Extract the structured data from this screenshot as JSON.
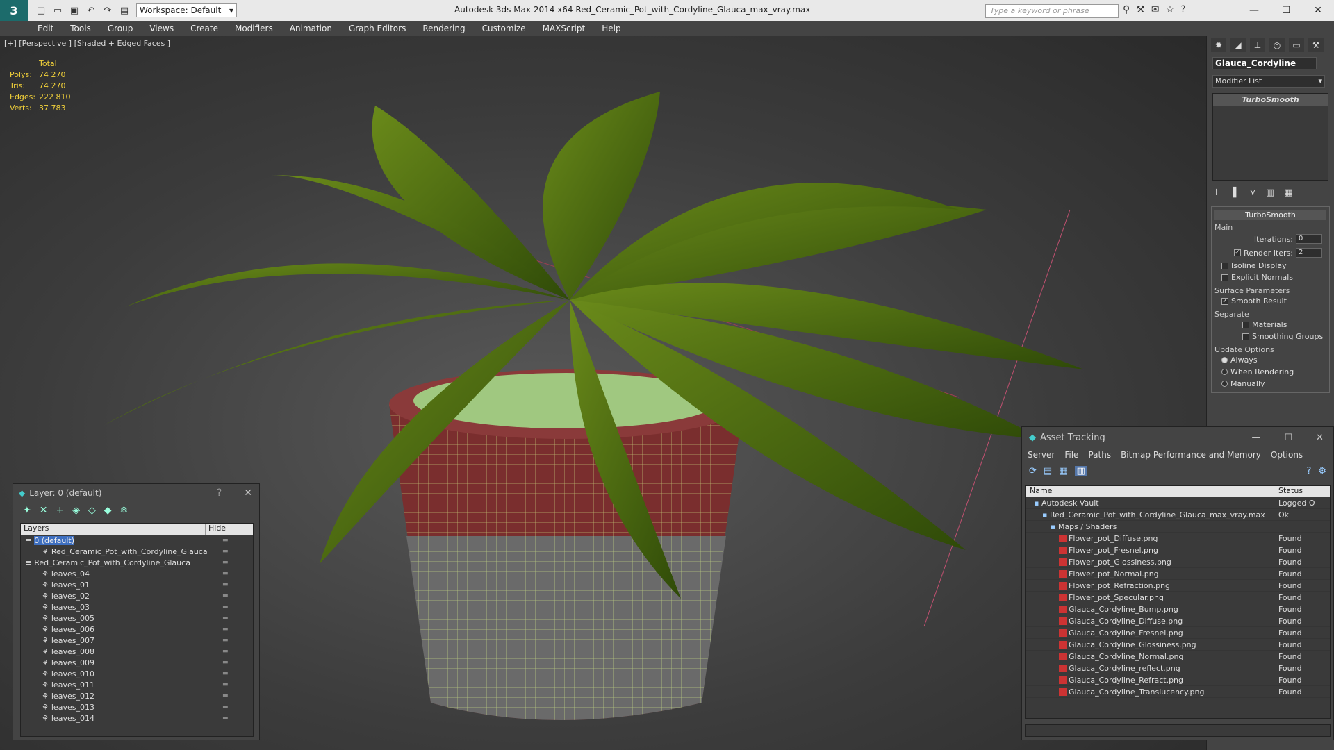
{
  "titlebar": {
    "workspace": "Workspace: Default",
    "title": "Autodesk 3ds Max  2014 x64      Red_Ceramic_Pot_with_Cordyline_Glauca_max_vray.max",
    "search_placeholder": "Type a keyword or phrase"
  },
  "menu": [
    "Edit",
    "Tools",
    "Group",
    "Views",
    "Create",
    "Modifiers",
    "Animation",
    "Graph Editors",
    "Rendering",
    "Customize",
    "MAXScript",
    "Help"
  ],
  "viewport": {
    "label": "[+] [Perspective ] [Shaded + Edged Faces ]",
    "stats_header": "Total",
    "stats": [
      {
        "k": "Polys:",
        "v": "74 270"
      },
      {
        "k": "Tris:",
        "v": "74 270"
      },
      {
        "k": "Edges:",
        "v": "222 810"
      },
      {
        "k": "Verts:",
        "v": "37 783"
      }
    ]
  },
  "command_panel": {
    "object_name": "Glauca_Cordyline",
    "modifier_list": "Modifier List",
    "stack_item": "TurboSmooth",
    "rollout_title": "TurboSmooth",
    "main_label": "Main",
    "iterations_label": "Iterations:",
    "iterations_value": "0",
    "render_iters_label": "Render Iters:",
    "render_iters_value": "2",
    "isoline": "Isoline Display",
    "explicit": "Explicit Normals",
    "surface_label": "Surface Parameters",
    "smooth_result": "Smooth Result",
    "separate": "Separate",
    "materials": "Materials",
    "smoothing_groups": "Smoothing Groups",
    "update_label": "Update Options",
    "always": "Always",
    "when_rendering": "When Rendering",
    "manually": "Manually"
  },
  "layer_window": {
    "title": "Layer: 0 (default)",
    "col_layers": "Layers",
    "col_hide": "Hide",
    "rows": [
      {
        "name": "0 (default)",
        "indent": 0,
        "selected": true
      },
      {
        "name": "Red_Ceramic_Pot_with_Cordyline_Glauca",
        "indent": 2,
        "selected": false
      },
      {
        "name": "Red_Ceramic_Pot_with_Cordyline_Glauca",
        "indent": 0,
        "selected": false
      },
      {
        "name": "leaves_04",
        "indent": 2,
        "selected": false
      },
      {
        "name": "leaves_01",
        "indent": 2,
        "selected": false
      },
      {
        "name": "leaves_02",
        "indent": 2,
        "selected": false
      },
      {
        "name": "leaves_03",
        "indent": 2,
        "selected": false
      },
      {
        "name": "leaves_005",
        "indent": 2,
        "selected": false
      },
      {
        "name": "leaves_006",
        "indent": 2,
        "selected": false
      },
      {
        "name": "leaves_007",
        "indent": 2,
        "selected": false
      },
      {
        "name": "leaves_008",
        "indent": 2,
        "selected": false
      },
      {
        "name": "leaves_009",
        "indent": 2,
        "selected": false
      },
      {
        "name": "leaves_010",
        "indent": 2,
        "selected": false
      },
      {
        "name": "leaves_011",
        "indent": 2,
        "selected": false
      },
      {
        "name": "leaves_012",
        "indent": 2,
        "selected": false
      },
      {
        "name": "leaves_013",
        "indent": 2,
        "selected": false
      },
      {
        "name": "leaves_014",
        "indent": 2,
        "selected": false
      }
    ]
  },
  "asset_window": {
    "title": "Asset Tracking",
    "menu": [
      "Server",
      "File",
      "Paths",
      "Bitmap Performance and Memory",
      "Options"
    ],
    "col_name": "Name",
    "col_status": "Status",
    "rows": [
      {
        "name": "Autodesk Vault",
        "status": "Logged O",
        "indent": 1,
        "png": false
      },
      {
        "name": "Red_Ceramic_Pot_with_Cordyline_Glauca_max_vray.max",
        "status": "Ok",
        "indent": 2,
        "png": false
      },
      {
        "name": "Maps / Shaders",
        "status": "",
        "indent": 3,
        "png": false
      },
      {
        "name": "Flower_pot_Diffuse.png",
        "status": "Found",
        "indent": 4,
        "png": true
      },
      {
        "name": "Flower_pot_Fresnel.png",
        "status": "Found",
        "indent": 4,
        "png": true
      },
      {
        "name": "Flower_pot_Glossiness.png",
        "status": "Found",
        "indent": 4,
        "png": true
      },
      {
        "name": "Flower_pot_Normal.png",
        "status": "Found",
        "indent": 4,
        "png": true
      },
      {
        "name": "Flower_pot_Refraction.png",
        "status": "Found",
        "indent": 4,
        "png": true
      },
      {
        "name": "Flower_pot_Specular.png",
        "status": "Found",
        "indent": 4,
        "png": true
      },
      {
        "name": "Glauca_Cordyline_Bump.png",
        "status": "Found",
        "indent": 4,
        "png": true
      },
      {
        "name": "Glauca_Cordyline_Diffuse.png",
        "status": "Found",
        "indent": 4,
        "png": true
      },
      {
        "name": "Glauca_Cordyline_Fresnel.png",
        "status": "Found",
        "indent": 4,
        "png": true
      },
      {
        "name": "Glauca_Cordyline_Glossiness.png",
        "status": "Found",
        "indent": 4,
        "png": true
      },
      {
        "name": "Glauca_Cordyline_Normal.png",
        "status": "Found",
        "indent": 4,
        "png": true
      },
      {
        "name": "Glauca_Cordyline_reflect.png",
        "status": "Found",
        "indent": 4,
        "png": true
      },
      {
        "name": "Glauca_Cordyline_Refract.png",
        "status": "Found",
        "indent": 4,
        "png": true
      },
      {
        "name": "Glauca_Cordyline_Translucency.png",
        "status": "Found",
        "indent": 4,
        "png": true
      }
    ]
  }
}
